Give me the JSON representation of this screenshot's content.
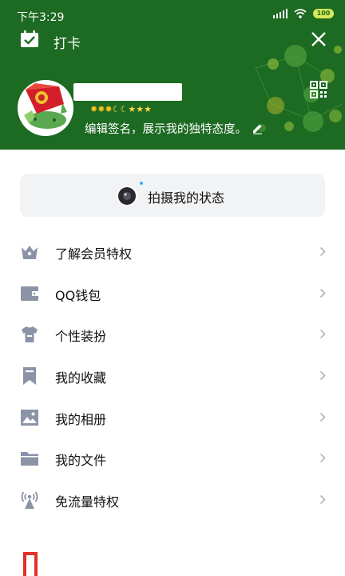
{
  "status_bar": {
    "time": "下午3:29",
    "battery": "100"
  },
  "topbar": {
    "checkin_label": "打卡"
  },
  "profile": {
    "level_icons": {
      "suns": "✹✹✹",
      "moons": "☾☾",
      "stars": "★★★"
    },
    "signature": "编辑签名，展示我的独特态度。"
  },
  "capture_status": {
    "label": "拍摄我的状态"
  },
  "menu": {
    "items": [
      {
        "label": "了解会员特权",
        "icon": "vip-crown-icon"
      },
      {
        "label": "QQ钱包",
        "icon": "wallet-icon"
      },
      {
        "label": "个性装扮",
        "icon": "shirt-icon"
      },
      {
        "label": "我的收藏",
        "icon": "bookmark-icon"
      },
      {
        "label": "我的相册",
        "icon": "photo-album-icon"
      },
      {
        "label": "我的文件",
        "icon": "folder-icon"
      },
      {
        "label": "免流量特权",
        "icon": "signal-tower-icon"
      }
    ]
  },
  "colors": {
    "header_green": "#1d6a22",
    "icon_gray": "#8b93a6",
    "accent_red": "#e0312b",
    "capture_bg": "#f2f3f5"
  }
}
